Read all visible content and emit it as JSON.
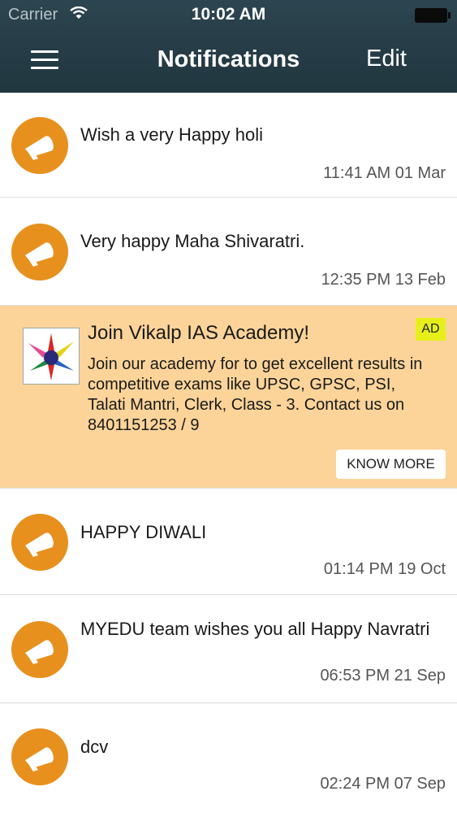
{
  "status_bar": {
    "carrier": "Carrier",
    "time": "10:02 AM"
  },
  "navbar": {
    "title": "Notifications",
    "edit_label": "Edit"
  },
  "notifications": [
    {
      "message": "Wish a very Happy holi",
      "time": "11:41 AM 01 Mar"
    },
    {
      "message": "Very happy Maha Shivaratri.",
      "time": "12:35 PM 13 Feb"
    },
    {
      "message": "HAPPY DIWALI",
      "time": "01:14 PM 19 Oct"
    },
    {
      "message": "MYEDU team wishes you all Happy Navratri",
      "time": "06:53 PM 21 Sep"
    },
    {
      "message": "dcv",
      "time": "02:24 PM 07 Sep"
    }
  ],
  "ad": {
    "title": "Join Vikalp IAS Academy!",
    "badge": "AD",
    "body": "Join our academy for to get excellent results in competitive exams like UPSC, GPSC, PSI, Talati Mantri, Clerk, Class - 3. Contact us on 8401151253 / 9",
    "button_label": "KNOW MORE"
  },
  "colors": {
    "navbar": "#20363f",
    "avatar": "#e8901e",
    "ad_background": "#fcd49a",
    "ad_badge": "#e6ef1a"
  },
  "icons": {
    "menu": "hamburger-icon",
    "notification": "megaphone-icon",
    "wifi": "wifi-icon",
    "battery": "battery-icon"
  }
}
